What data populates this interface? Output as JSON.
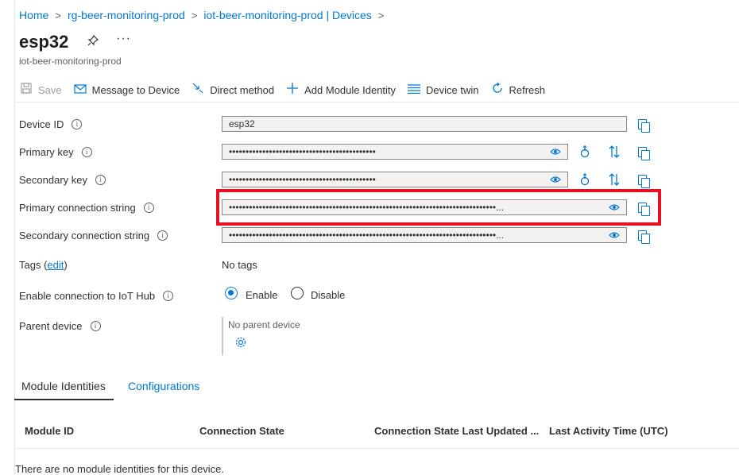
{
  "breadcrumb": [
    "Home",
    "rg-beer-monitoring-prod",
    "iot-beer-monitoring-prod | Devices"
  ],
  "header": {
    "title": "esp32",
    "subtitle": "iot-beer-monitoring-prod"
  },
  "toolbar": {
    "save": "Save",
    "message": "Message to Device",
    "direct": "Direct method",
    "add_module": "Add Module Identity",
    "twin": "Device twin",
    "refresh": "Refresh"
  },
  "fields": {
    "device_id_label": "Device ID",
    "device_id_value": "esp32",
    "primary_key_label": "Primary key",
    "primary_key_value": "••••••••••••••••••••••••••••••••••••••••••••",
    "secondary_key_label": "Secondary key",
    "secondary_key_value": "••••••••••••••••••••••••••••••••••••••••••••",
    "primary_conn_label": "Primary connection string",
    "primary_conn_value": "••••••••••••••••••••••••••••••••••••••••••••••••••••••••••••••••••••••••••••••••...",
    "secondary_conn_label": "Secondary connection string",
    "secondary_conn_value": "••••••••••••••••••••••••••••••••••••••••••••••••••••••••••••••••••••••••••••••••...",
    "tags_label": "Tags",
    "tags_edit": "edit",
    "tags_value": "No tags",
    "enable_label": "Enable connection to IoT Hub",
    "enable_option": "Enable",
    "disable_option": "Disable",
    "parent_label": "Parent device",
    "parent_value": "No parent device"
  },
  "tabs": [
    "Module Identities",
    "Configurations"
  ],
  "table": {
    "columns": [
      "Module ID",
      "Connection State",
      "Connection State Last Updated ...",
      "Last Activity Time (UTC)"
    ],
    "empty": "There are no module identities for this device."
  },
  "colors": {
    "accent": "#0078d4",
    "highlight": "#e81123"
  }
}
